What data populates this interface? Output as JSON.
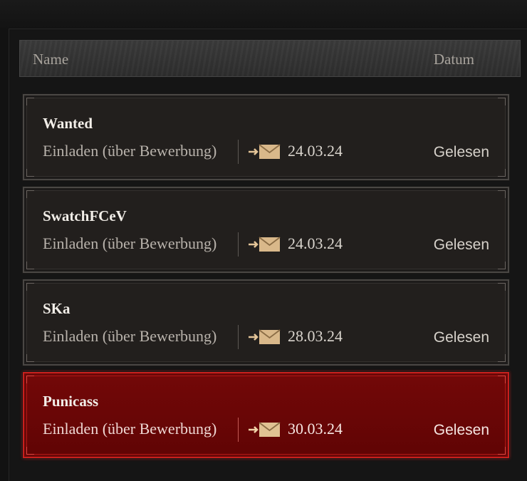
{
  "header": {
    "name_label": "Name",
    "date_label": "Datum"
  },
  "rows": [
    {
      "name": "Wanted",
      "action": "Einladen (über Bewerbung)",
      "icon": "envelope-arrow-icon",
      "date": "24.03.24",
      "status": "Gelesen",
      "selected": false
    },
    {
      "name": "SwatchFCeV",
      "action": "Einladen (über Bewerbung)",
      "icon": "envelope-arrow-icon",
      "date": "24.03.24",
      "status": "Gelesen",
      "selected": false
    },
    {
      "name": "SKa",
      "action": "Einladen (über Bewerbung)",
      "icon": "envelope-arrow-icon",
      "date": "28.03.24",
      "status": "Gelesen",
      "selected": false
    },
    {
      "name": "Punicass",
      "action": "Einladen (über Bewerbung)",
      "icon": "envelope-arrow-icon",
      "date": "30.03.24",
      "status": "Gelesen",
      "selected": true
    }
  ],
  "colors": {
    "selected_row": "#6a0606",
    "selected_border": "#c8201d",
    "row_bg": "#221f1d",
    "envelope": "#d9b88a"
  }
}
